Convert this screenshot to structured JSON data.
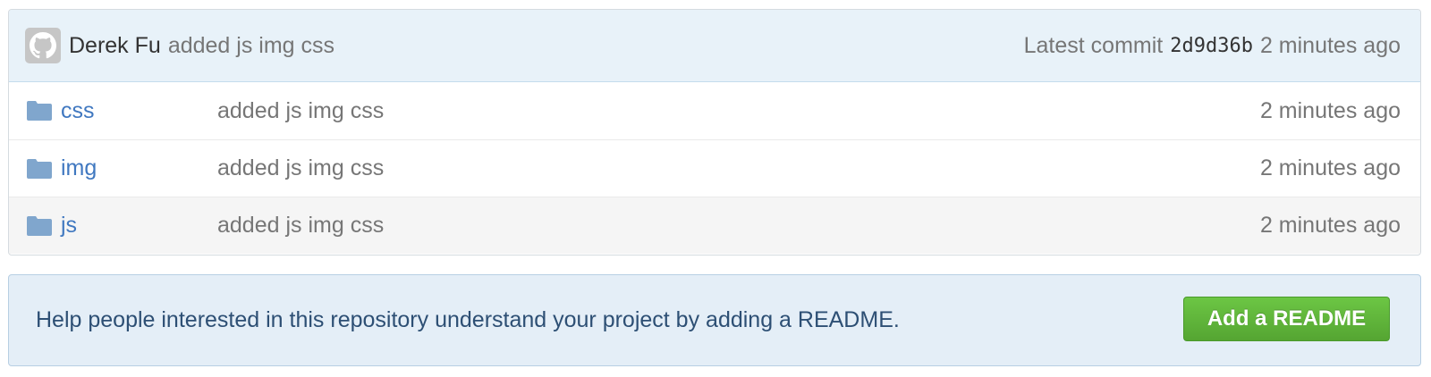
{
  "latest_commit": {
    "author": "Derek Fu",
    "message": "added js img css",
    "label": "Latest commit",
    "sha": "2d9d36b",
    "age": "2 minutes ago"
  },
  "files": [
    {
      "name": "css",
      "message": "added js img css",
      "age": "2 minutes ago",
      "icon": "folder-icon"
    },
    {
      "name": "img",
      "message": "added js img css",
      "age": "2 minutes ago",
      "icon": "folder-icon"
    },
    {
      "name": "js",
      "message": "added js img css",
      "age": "2 minutes ago",
      "icon": "folder-icon"
    }
  ],
  "readme_prompt": {
    "text": "Help people interested in this repository understand your project by adding a README.",
    "button_label": "Add a README"
  },
  "colors": {
    "link": "#4078c0",
    "folder": "#80a6cd",
    "button": "#55a532",
    "commit_bar_bg": "#e8f2f9"
  }
}
